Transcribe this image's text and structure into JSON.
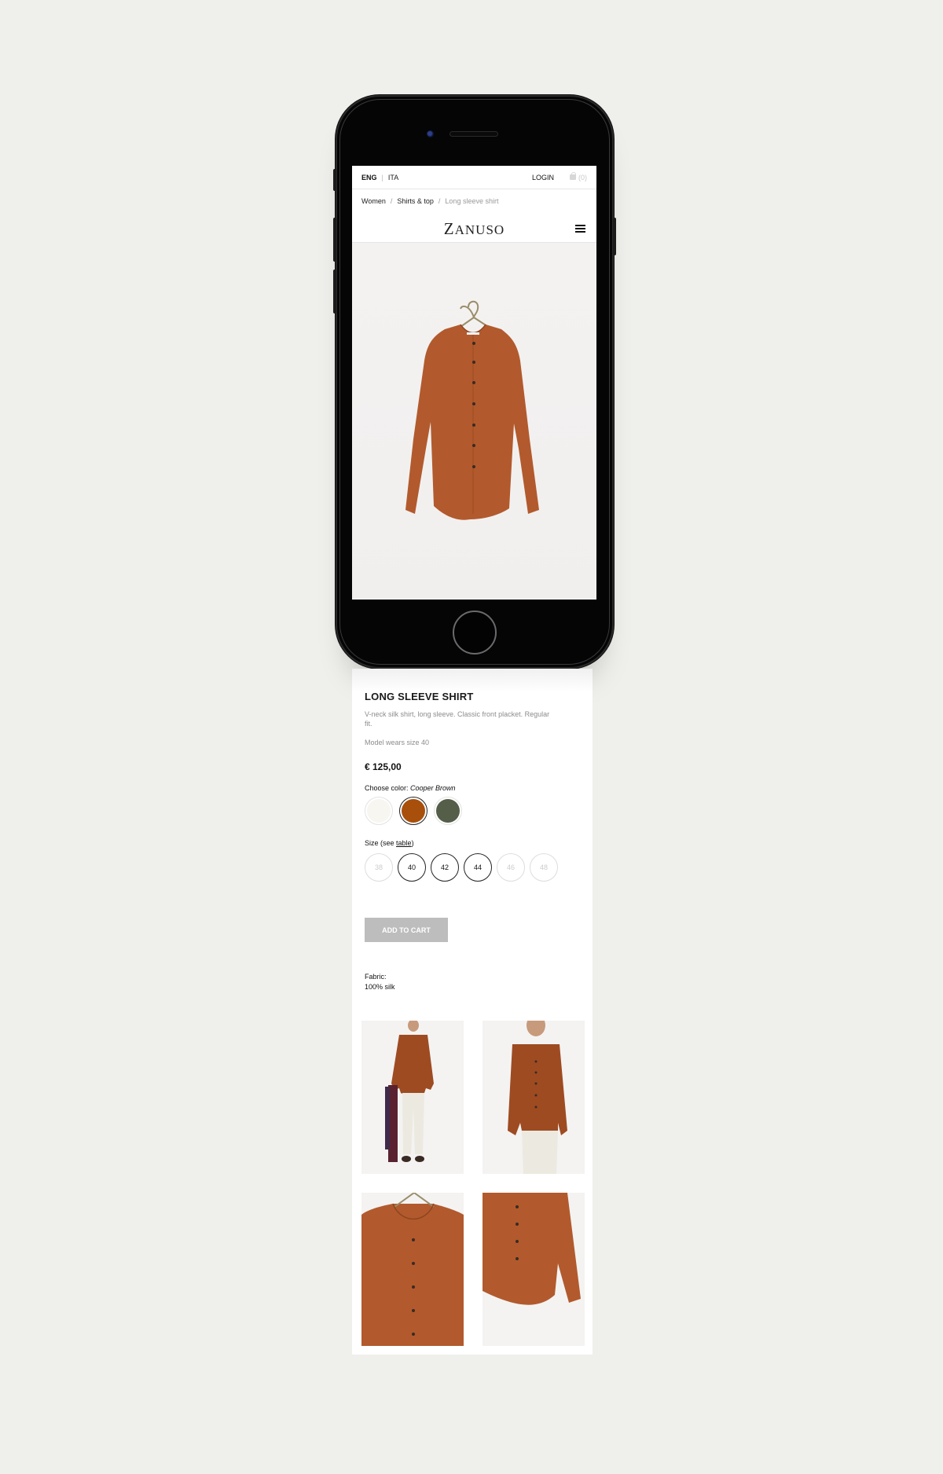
{
  "topbar": {
    "languages": [
      {
        "label": "ENG",
        "active": true
      },
      {
        "label": "ITA",
        "active": false
      }
    ],
    "separator": "|",
    "login_label": "LOGIN",
    "cart_count": "(0)",
    "cart_icon": "shopping-bag-icon"
  },
  "breadcrumb": {
    "items": [
      "Women",
      "Shirts & top",
      "Long sleeve shirt"
    ],
    "separator": "/"
  },
  "header": {
    "logo_first": "Z",
    "logo_rest": "ANUSO",
    "menu_icon": "hamburger-menu-icon"
  },
  "hero": {
    "image_alt": "Long sleeve shirt on hanger",
    "shirt_color": "#b25a2d"
  },
  "product": {
    "title": "LONG SLEEVE SHIRT",
    "description": "V-neck silk shirt, long sleeve. Classic front placket. Regular fit.",
    "model_info": "Model wears size 40",
    "price": "€ 125,00",
    "color_label": "Choose color: ",
    "selected_color": "Cooper Brown",
    "colors": [
      {
        "name": "Ivory",
        "hex": "#f7f6f1",
        "selected": false
      },
      {
        "name": "Cooper Brown",
        "hex": "#a84f0c",
        "selected": true
      },
      {
        "name": "Olive Green",
        "hex": "#555e48",
        "selected": false
      }
    ],
    "size_label": "Size (see ",
    "size_link": "table",
    "size_label_end": ")",
    "sizes": [
      {
        "label": "38",
        "available": false
      },
      {
        "label": "40",
        "available": true
      },
      {
        "label": "42",
        "available": true
      },
      {
        "label": "44",
        "available": true
      },
      {
        "label": "46",
        "available": false
      },
      {
        "label": "48",
        "available": false
      }
    ],
    "add_to_cart_label": "ADD TO CART",
    "fabric_label": "Fabric:",
    "fabric_value": "100% silk"
  },
  "gallery": {
    "images": [
      {
        "alt": "Model full length front view"
      },
      {
        "alt": "Model torso front view"
      },
      {
        "alt": "Shirt on hanger detail"
      },
      {
        "alt": "Shirt hem and sleeve detail"
      }
    ]
  }
}
